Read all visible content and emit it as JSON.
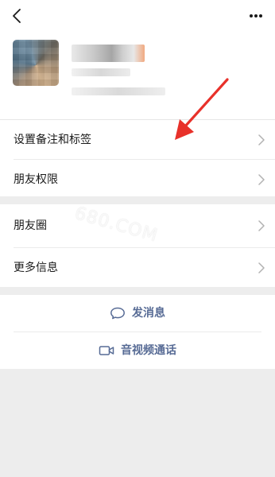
{
  "navbar": {
    "back_icon": "chevron-left-icon",
    "more_icon": "more-horizontal-icon"
  },
  "profile": {
    "avatar_icon": "avatar-image-blurred"
  },
  "sections": {
    "settings": [
      {
        "label": "设置备注和标签",
        "icon": "chevron-right-icon"
      },
      {
        "label": "朋友权限",
        "icon": "chevron-right-icon"
      }
    ],
    "info": [
      {
        "label": "朋友圈",
        "icon": "chevron-right-icon"
      },
      {
        "label": "更多信息",
        "icon": "chevron-right-icon"
      }
    ]
  },
  "actions": {
    "message": {
      "label": "发消息",
      "icon": "chat-bubble-icon"
    },
    "video_call": {
      "label": "音视频通话",
      "icon": "video-camera-icon"
    }
  },
  "watermark": "680.COM",
  "colors": {
    "link_blue": "#576b95",
    "arrow_red": "#e8312a",
    "page_bg": "#ededed",
    "chevron_gray": "#b2b2b2"
  }
}
